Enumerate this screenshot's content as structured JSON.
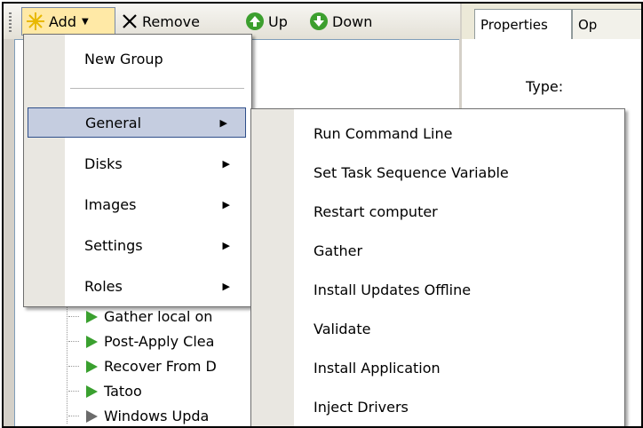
{
  "toolbar": {
    "add": "Add",
    "remove": "Remove",
    "up": "Up",
    "down": "Down"
  },
  "tabs": {
    "properties": "Properties",
    "options": "Op"
  },
  "properties_panel": {
    "type_label": "Type:"
  },
  "tree": {
    "items": [
      "Gather local on",
      "Post-Apply Clea",
      "Recover From D",
      "Tatoo",
      "Windows Upda"
    ]
  },
  "add_menu": {
    "new_group": "New Group",
    "items": [
      "General",
      "Disks",
      "Images",
      "Settings",
      "Roles"
    ]
  },
  "general_submenu": {
    "items": [
      "Run Command Line",
      "Set Task Sequence Variable",
      "Restart computer",
      "Gather",
      "Install Updates Offline",
      "Validate",
      "Install Application",
      "Inject Drivers"
    ]
  },
  "colors": {
    "highlight": "#c5cde0",
    "highlight_border": "#2f4f8a",
    "run_arrow": "#3aa02f"
  }
}
